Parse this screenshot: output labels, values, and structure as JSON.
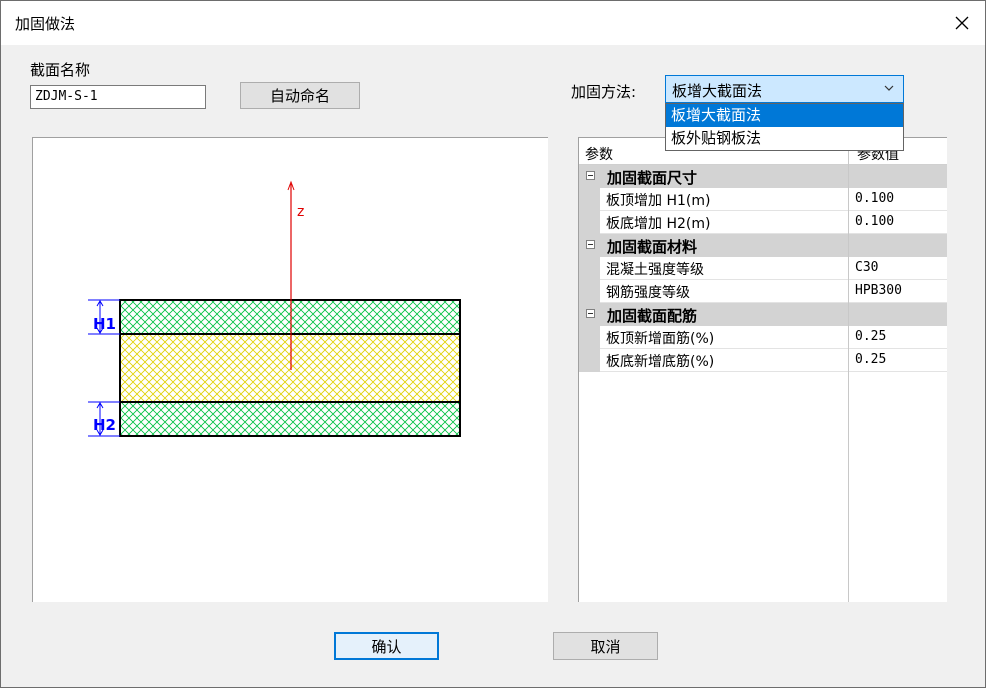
{
  "window": {
    "title": "加固做法",
    "close_glyph": "✕"
  },
  "section_name": {
    "label": "截面名称",
    "value": "ZDJM-S-1",
    "auto_button": "自动命名"
  },
  "method": {
    "label": "加固方法:",
    "selected": "板增大截面法",
    "options": [
      "板增大截面法",
      "板外贴钢板法"
    ]
  },
  "preview": {
    "axis_label": "z",
    "h1_label": "H1",
    "h2_label": "H2"
  },
  "grid": {
    "col_param": "参数",
    "col_value": "参数值",
    "groups": [
      {
        "title": "加固截面尺寸",
        "rows": [
          {
            "name": "板顶增加 H1(m)",
            "value": "0.100"
          },
          {
            "name": "板底增加 H2(m)",
            "value": "0.100"
          }
        ]
      },
      {
        "title": "加固截面材料",
        "rows": [
          {
            "name": "混凝土强度等级",
            "value": "C30"
          },
          {
            "name": "钢筋强度等级",
            "value": "HPB300"
          }
        ]
      },
      {
        "title": "加固截面配筋",
        "rows": [
          {
            "name": "板顶新增面筋(%)",
            "value": "0.25"
          },
          {
            "name": "板底新增底筋(%)",
            "value": "0.25"
          }
        ]
      }
    ]
  },
  "buttons": {
    "ok": "确认",
    "cancel": "取消"
  },
  "colors": {
    "accent": "#0078d7",
    "hatch_green": "#00c040",
    "hatch_yellow": "#e0d000",
    "axis_red": "#e00000",
    "dim_blue": "#0000ff"
  }
}
